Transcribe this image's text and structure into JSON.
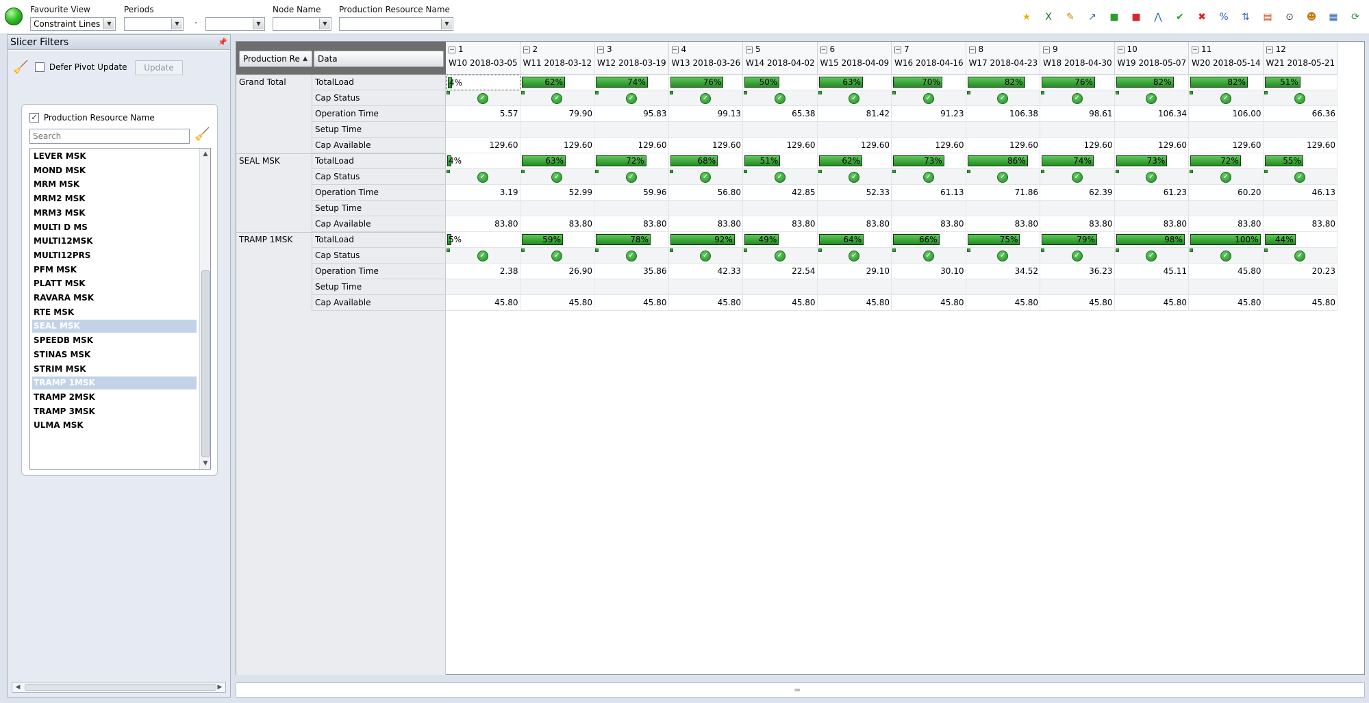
{
  "toolbar": {
    "favourite_view": {
      "label": "Favourite View",
      "value": "Constraint Lines"
    },
    "periods": {
      "label": "Periods",
      "from": "",
      "to": "",
      "separator": "-"
    },
    "node_name": {
      "label": "Node Name",
      "value": ""
    },
    "production_resource": {
      "label": "Production Resource Name",
      "value": ""
    },
    "icons": [
      {
        "name": "new-view-icon",
        "glyph": "★",
        "color": "#e8b400"
      },
      {
        "name": "excel-export-icon",
        "glyph": "X",
        "color": "#1d7a3a"
      },
      {
        "name": "edit-icon",
        "glyph": "✎",
        "color": "#d08a00"
      },
      {
        "name": "chart-edit-icon",
        "glyph": "↗",
        "color": "#2d5fb8"
      },
      {
        "name": "green-square-icon",
        "glyph": "■",
        "color": "#2aa02a"
      },
      {
        "name": "red-square-icon",
        "glyph": "■",
        "color": "#d9262b"
      },
      {
        "name": "line-chart-icon",
        "glyph": "⋀",
        "color": "#2d5fb8"
      },
      {
        "name": "ok-icon",
        "glyph": "✔",
        "color": "#2aa02a"
      },
      {
        "name": "cancel-icon",
        "glyph": "✖",
        "color": "#d9262b"
      },
      {
        "name": "percent-icon",
        "glyph": "%",
        "color": "#2d5fb8"
      },
      {
        "name": "sort-icon",
        "glyph": "⇅",
        "color": "#2d5fb8"
      },
      {
        "name": "report-icon",
        "glyph": "▤",
        "color": "#d04a1a"
      },
      {
        "name": "binoculars-icon",
        "glyph": "⊙",
        "color": "#444444"
      },
      {
        "name": "users-icon",
        "glyph": "☻",
        "color": "#c47a10"
      },
      {
        "name": "layout-icon",
        "glyph": "▦",
        "color": "#2d5fb8"
      },
      {
        "name": "refresh-icon",
        "glyph": "⟳",
        "color": "#1a8a3a"
      }
    ]
  },
  "slicer": {
    "title": "Slicer Filters",
    "defer_label": "Defer Pivot Update",
    "update_label": "Update",
    "resource_filter": {
      "title": "Production Resource Name",
      "checked": "✓",
      "search_placeholder": "Search",
      "items": [
        {
          "label": "LEVER MSK",
          "selected": false
        },
        {
          "label": "MOND MSK",
          "selected": false
        },
        {
          "label": "MRM MSK",
          "selected": false
        },
        {
          "label": "MRM2 MSK",
          "selected": false
        },
        {
          "label": "MRM3 MSK",
          "selected": false
        },
        {
          "label": "MULTI D MS",
          "selected": false
        },
        {
          "label": "MULTI12MSK",
          "selected": false
        },
        {
          "label": "MULTI12PRS",
          "selected": false
        },
        {
          "label": "PFM MSK",
          "selected": false
        },
        {
          "label": "PLATT MSK",
          "selected": false
        },
        {
          "label": "RAVARA MSK",
          "selected": false
        },
        {
          "label": "RTE MSK",
          "selected": false
        },
        {
          "label": "SEAL MSK",
          "selected": true
        },
        {
          "label": "SPEEDB MSK",
          "selected": false
        },
        {
          "label": "STINAS MSK",
          "selected": false
        },
        {
          "label": "STRIM MSK",
          "selected": false
        },
        {
          "label": "TRAMP 1MSK",
          "selected": true
        },
        {
          "label": "TRAMP 2MSK",
          "selected": false
        },
        {
          "label": "TRAMP 3MSK",
          "selected": false
        },
        {
          "label": "ULMA MSK",
          "selected": false
        }
      ]
    }
  },
  "pivot": {
    "row_field": "Production Re",
    "data_field": "Data",
    "columns": [
      {
        "num": "1",
        "date": "W10 2018-03-05"
      },
      {
        "num": "2",
        "date": "W11 2018-03-12"
      },
      {
        "num": "3",
        "date": "W12 2018-03-19"
      },
      {
        "num": "4",
        "date": "W13 2018-03-26"
      },
      {
        "num": "5",
        "date": "W14 2018-04-02"
      },
      {
        "num": "6",
        "date": "W15 2018-04-09"
      },
      {
        "num": "7",
        "date": "W16 2018-04-16"
      },
      {
        "num": "8",
        "date": "W17 2018-04-23"
      },
      {
        "num": "9",
        "date": "W18 2018-04-30"
      },
      {
        "num": "10",
        "date": "W19 2018-05-07"
      },
      {
        "num": "11",
        "date": "W20 2018-05-14"
      },
      {
        "num": "12",
        "date": "W21 2018-05-21"
      }
    ],
    "row_labels": [
      "TotalLoad",
      "Cap Status",
      "Operation Time",
      "Setup Time",
      "Cap Available"
    ],
    "groups": [
      {
        "name": "Grand Total",
        "first_pct_text": "4%",
        "totalload": [
          4,
          62,
          74,
          76,
          50,
          63,
          70,
          82,
          76,
          82,
          82,
          51
        ],
        "operation_time": [
          "5.57",
          "79.90",
          "95.83",
          "99.13",
          "65.38",
          "81.42",
          "91.23",
          "106.38",
          "98.61",
          "106.34",
          "106.00",
          "66.36"
        ],
        "setup_time": [
          "",
          "",
          "",
          "",
          "",
          "",
          "",
          "",
          "",
          "",
          "",
          ""
        ],
        "cap_available": [
          "129.60",
          "129.60",
          "129.60",
          "129.60",
          "129.60",
          "129.60",
          "129.60",
          "129.60",
          "129.60",
          "129.60",
          "129.60",
          "129.60"
        ]
      },
      {
        "name": "SEAL MSK",
        "first_pct_text": "4%",
        "totalload": [
          4,
          63,
          72,
          68,
          51,
          62,
          73,
          86,
          74,
          73,
          72,
          55
        ],
        "operation_time": [
          "3.19",
          "52.99",
          "59.96",
          "56.80",
          "42.85",
          "52.33",
          "61.13",
          "71.86",
          "62.39",
          "61.23",
          "60.20",
          "46.13"
        ],
        "setup_time": [
          "",
          "",
          "",
          "",
          "",
          "",
          "",
          "",
          "",
          "",
          "",
          ""
        ],
        "cap_available": [
          "83.80",
          "83.80",
          "83.80",
          "83.80",
          "83.80",
          "83.80",
          "83.80",
          "83.80",
          "83.80",
          "83.80",
          "83.80",
          "83.80"
        ]
      },
      {
        "name": "TRAMP 1MSK",
        "first_pct_text": "5%",
        "totalload": [
          5,
          59,
          78,
          92,
          49,
          64,
          66,
          75,
          79,
          98,
          100,
          44
        ],
        "operation_time": [
          "2.38",
          "26.90",
          "35.86",
          "42.33",
          "22.54",
          "29.10",
          "30.10",
          "34.52",
          "36.23",
          "45.11",
          "45.80",
          "20.23"
        ],
        "setup_time": [
          "",
          "",
          "",
          "",
          "",
          "",
          "",
          "",
          "",
          "",
          "",
          ""
        ],
        "cap_available": [
          "45.80",
          "45.80",
          "45.80",
          "45.80",
          "45.80",
          "45.80",
          "45.80",
          "45.80",
          "45.80",
          "45.80",
          "45.80",
          "45.80"
        ]
      }
    ]
  }
}
